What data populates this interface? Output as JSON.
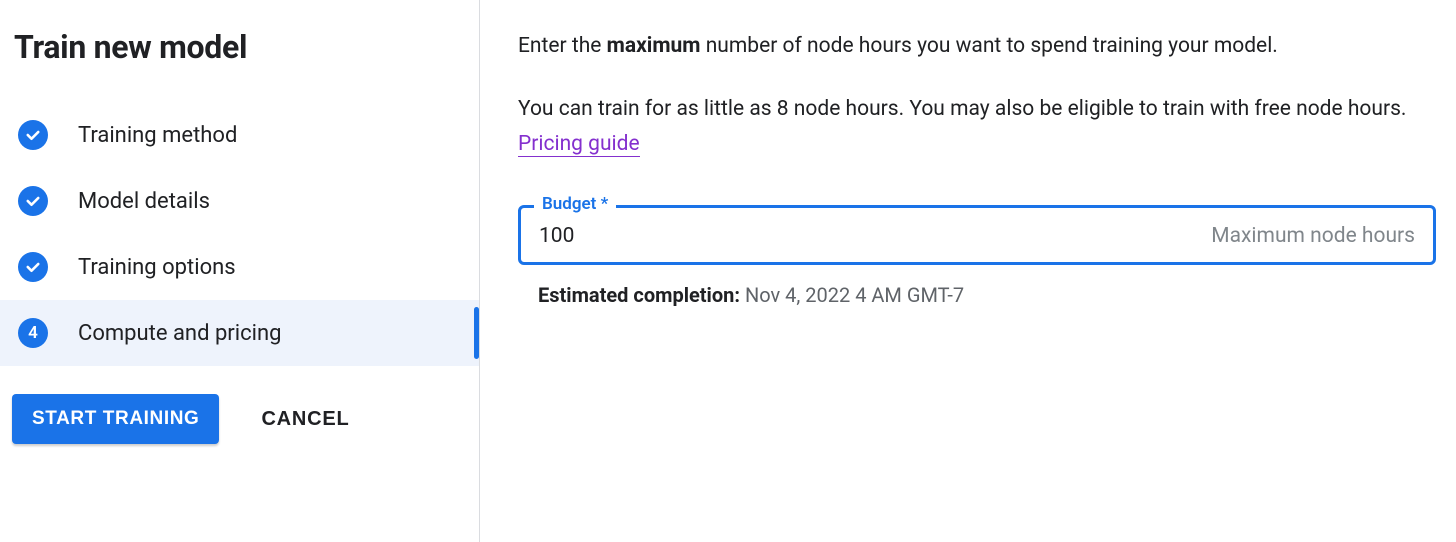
{
  "title": "Train new model",
  "steps": [
    {
      "label": "Training method",
      "done": true
    },
    {
      "label": "Model details",
      "done": true
    },
    {
      "label": "Training options",
      "done": true
    },
    {
      "label": "Compute and pricing",
      "num": "4",
      "active": true
    }
  ],
  "buttons": {
    "primary": "START TRAINING",
    "cancel": "CANCEL"
  },
  "main": {
    "intro_pre": "Enter the ",
    "intro_bold": "maximum",
    "intro_post": " number of node hours you want to spend training your model.",
    "para2_text": "You can train for as little as 8 node hours. You may also be eligible to train with free node hours. ",
    "link_label": "Pricing guide",
    "budget_label": "Budget *",
    "budget_value": "100",
    "budget_suffix": "Maximum node hours",
    "est_label": "Estimated completion:",
    "est_value": "Nov 4, 2022 4 AM GMT-7"
  }
}
